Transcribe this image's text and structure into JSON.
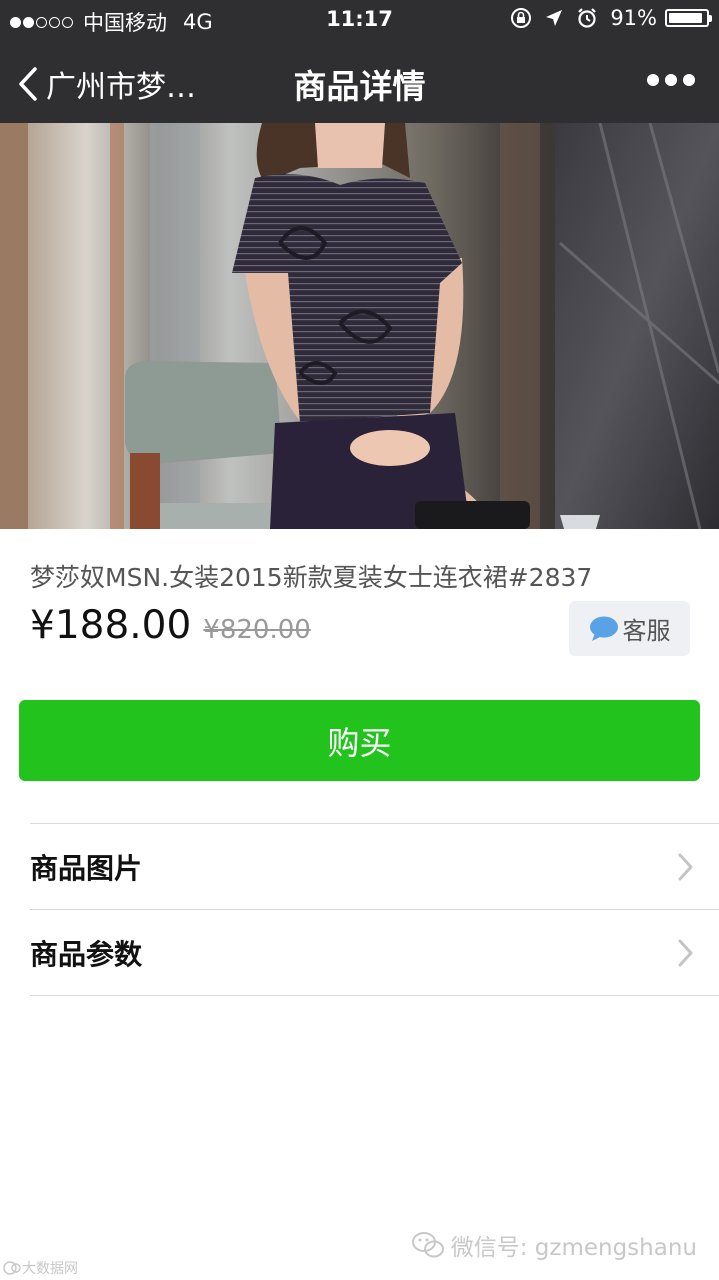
{
  "status_bar": {
    "carrier": "中国移动",
    "network": "4G",
    "time": "11:17",
    "battery_percent": "91%",
    "battery_level": 0.91,
    "signal_bars_filled": 2,
    "signal_bars_total": 5
  },
  "nav": {
    "back_label": "广州市梦…",
    "title": "商品详情"
  },
  "product": {
    "title": "梦莎奴MSN.女装2015新款夏装女士连衣裙#2837",
    "price": "¥188.00",
    "original_price": "¥820.00",
    "service_label": "客服",
    "buy_label": "购买"
  },
  "menu": [
    {
      "label": "商品图片"
    },
    {
      "label": "商品参数"
    }
  ],
  "watermark": {
    "wechat_label": "微信号: gzmengshanu",
    "corner_label": "大数据网"
  },
  "colors": {
    "bar_background": "#2f2f31",
    "buy_button": "#22c31d",
    "service_icon": "#5aa2e6"
  }
}
